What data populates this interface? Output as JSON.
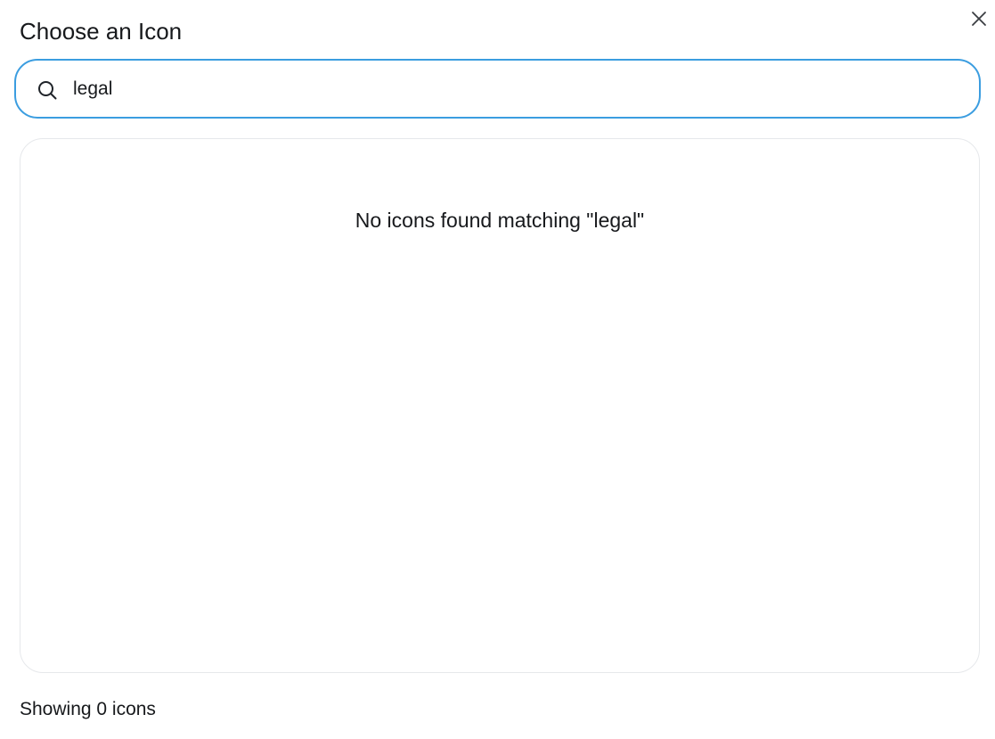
{
  "dialog": {
    "title": "Choose an Icon",
    "close_icon": "close-icon"
  },
  "search": {
    "icon": "search-icon",
    "value": "legal",
    "accent_color": "#3b9de0"
  },
  "results": {
    "empty_message": "No icons found matching \"legal\""
  },
  "footer": {
    "count_text": "Showing 0 icons"
  }
}
